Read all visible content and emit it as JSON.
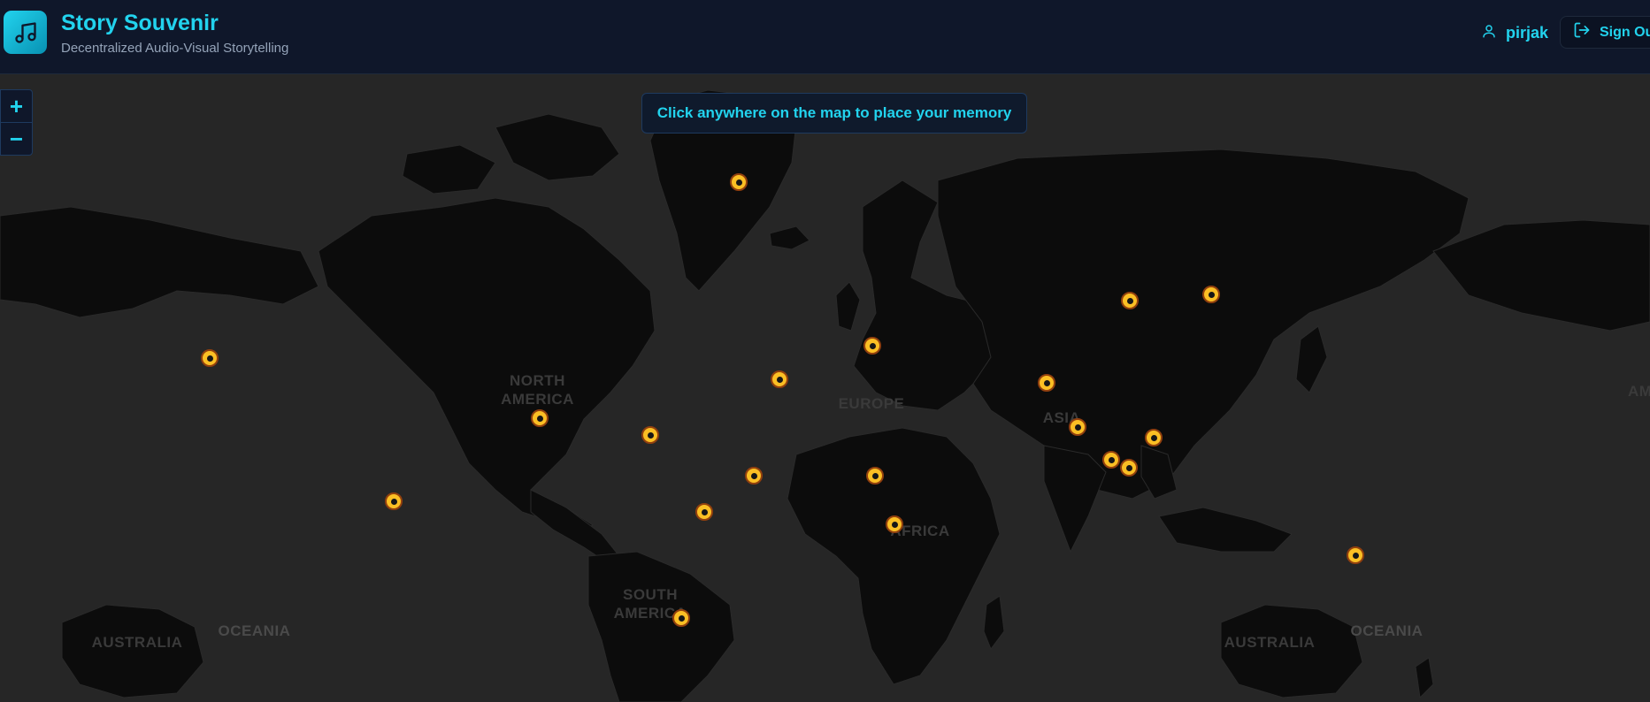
{
  "header": {
    "title": "Story Souvenir",
    "subtitle": "Decentralized Audio-Visual Storytelling",
    "username": "pirjak",
    "sign_out_label": "Sign Out"
  },
  "map": {
    "hint": "Click anywhere on the map to place your memory",
    "zoom_in_label": "+",
    "zoom_out_label": "−",
    "labels": {
      "north_america": "NORTH\nAMERICA",
      "europe": "EUROPE",
      "asia": "ASIA",
      "africa": "AFRICA",
      "south_america": "SOUTH\nAMERICA",
      "australia_left": "AUSTRALIA",
      "oceania_left": "OCEANIA",
      "australia_right": "AUSTRALIA",
      "oceania_right": "OCEANIA",
      "america_edge": "AM"
    },
    "marker_count": 22
  },
  "colors": {
    "accent": "#22d3ee",
    "header_bg": "#0f172a",
    "map_ocean": "#262626",
    "map_land": "#0c0c0c",
    "marker": "#fbbf24"
  }
}
